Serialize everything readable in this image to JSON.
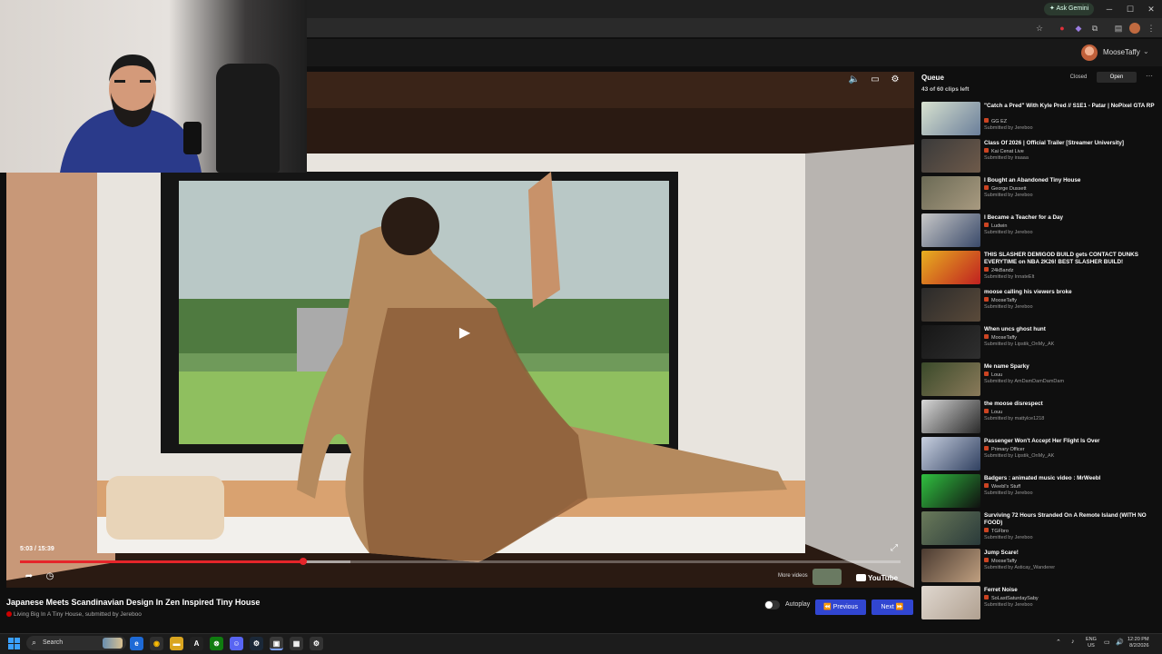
{
  "browser": {
    "ask_gemini": "Ask Gemini"
  },
  "header": {
    "username": "MooseTaffy"
  },
  "player": {
    "time": "5:03 / 15:39",
    "progress_played": 0.322,
    "progress_buffered": 0.375,
    "more_videos": "More videos",
    "youtube_logo": "YouTube"
  },
  "video": {
    "title": "Japanese Meets Scandinavian Design In Zen Inspired Tiny House",
    "channel": "Living Big In A Tiny House",
    "submitted_by": ", submitted by Jereboo"
  },
  "controls": {
    "autoplay_label": "Autoplay",
    "previous_label": "Previous",
    "next_label": "Next"
  },
  "queue": {
    "title": "Queue",
    "count": "43 of 60 clips left",
    "tab_closed": "Closed",
    "tab_open": "Open",
    "items": [
      {
        "title": "\"Catch a Pred\" With Kyle Pred // S1E1 - Patar | NoPixel GTA RP",
        "channel": "GG EZ",
        "submitted": "Submitted by Jereboo"
      },
      {
        "title": "Class Of 2026 | Official Trailer [Streamer University]",
        "channel": "Kai Cenat Live",
        "submitted": "Submitted by iraaaa"
      },
      {
        "title": "I Bought an Abandoned Tiny House",
        "channel": "George Dussett",
        "submitted": "Submitted by Jereboo"
      },
      {
        "title": "I Became a Teacher for a Day",
        "channel": "Ludwin",
        "submitted": "Submitted by Jereboo"
      },
      {
        "title": "THIS SLASHER DEMIGOD BUILD gets CONTACT DUNKS EVERYTIME on NBA 2K26! BEST SLASHER BUILD!",
        "channel": "24kBandz",
        "submitted": "Submitted by InnateElt"
      },
      {
        "title": "moose calling his viewers broke",
        "channel": "MooseTaffy",
        "submitted": "Submitted by Jereboo"
      },
      {
        "title": "When uncs ghost hunt",
        "channel": "MooseTaffy",
        "submitted": "Submitted by Lipstik_OnMy_AK"
      },
      {
        "title": "Me name Sparky",
        "channel": "Louu",
        "submitted": "Submitted by AmDamDamDamDam"
      },
      {
        "title": "the moose disrespect",
        "channel": "Louu",
        "submitted": "Submitted by mattylce1218"
      },
      {
        "title": "Passenger Won't Accept Her Flight Is Over",
        "channel": "Primary Officer",
        "submitted": "Submitted by Lipstik_OnMy_AK"
      },
      {
        "title": "Badgers : animated music video : MrWeebl",
        "channel": "Weebl's Stuff",
        "submitted": "Submitted by Jereboo"
      },
      {
        "title": "Surviving 72 Hours Stranded On A Remote Island (WITH NO FOOD)",
        "channel": "TGFbro",
        "submitted": "Submitted by Jereboo"
      },
      {
        "title": "Jump Scare!",
        "channel": "MooseTaffy",
        "submitted": "Submitted by Asticay_Wanderer"
      },
      {
        "title": "Ferret Noise",
        "channel": "SoLastSaturdaySaby",
        "submitted": "Submitted by Jereboo"
      }
    ]
  },
  "taskbar": {
    "search_placeholder": "Search",
    "lang_line1": "ENG",
    "lang_line2": "US",
    "time": "12:20 PM",
    "date": "8/2/2026"
  },
  "colors": {
    "accent_red": "#e5252a",
    "button_blue": "#3146d1",
    "background": "#0f0f0f"
  }
}
